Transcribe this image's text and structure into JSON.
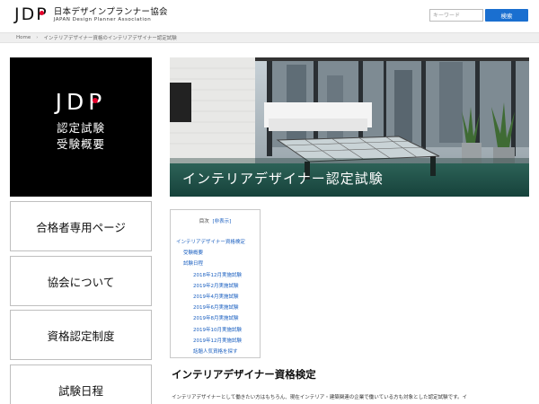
{
  "header": {
    "logo_mark_j": "J",
    "logo_mark_d": "D",
    "logo_mark_p": "P",
    "logo_jp": "日本デザインプランナー協会",
    "logo_en": "JAPAN Design Planner Association",
    "search_placeholder": "キーワード",
    "search_button": "検索"
  },
  "breadcrumb": {
    "home": "Home",
    "separator": "›",
    "current": "インテリアデザイナー資格のインテリアデザイナー認定試験"
  },
  "sidebar": {
    "hero_logo_j": "J",
    "hero_logo_d": "D",
    "hero_logo_p": "P",
    "hero_line1": "認定試験",
    "hero_line2": "受験概要",
    "items": [
      {
        "label": "合格者専用ページ"
      },
      {
        "label": "協会について"
      },
      {
        "label": "資格認定制度"
      },
      {
        "label": "試験日程"
      }
    ]
  },
  "banner": {
    "caption": "インテリアデザイナー認定試験"
  },
  "toc": {
    "title": "目次",
    "toggle": "[非表示]",
    "items": [
      {
        "label": "インテリアデザイナー資格検定",
        "level": 1
      },
      {
        "label": "受験概要",
        "level": 2
      },
      {
        "label": "試験日程",
        "level": 2
      },
      {
        "label": "2018年12月実施試験",
        "level": 3
      },
      {
        "label": "2019年2月実施試験",
        "level": 3
      },
      {
        "label": "2019年4月実施試験",
        "level": 3
      },
      {
        "label": "2019年6月実施試験",
        "level": 3
      },
      {
        "label": "2019年8月実施試験",
        "level": 3
      },
      {
        "label": "2019年10月実施試験",
        "level": 3
      },
      {
        "label": "2019年12月実施試験",
        "level": 3
      },
      {
        "label": "話題人気資格を探す",
        "level": 3
      }
    ]
  },
  "section": {
    "heading": "インテリアデザイナー資格検定",
    "text": "インテリアデザイナーとして働きたい方はもちろん、現在インテリア・建築関連の企業で働いている方も対象とした認定試験です。イ"
  },
  "colors": {
    "accent_blue": "#1a6fd0",
    "logo_red": "#e4002b",
    "link_blue": "#1a5fc0"
  }
}
